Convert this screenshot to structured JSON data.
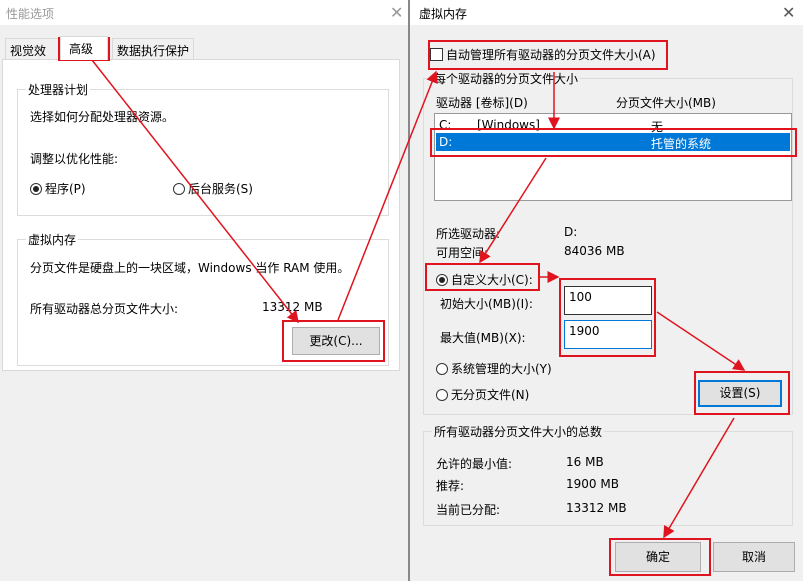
{
  "left_window": {
    "title": "性能选项",
    "tabs": [
      {
        "label": "视觉效果"
      },
      {
        "label": "高级",
        "selected": true
      },
      {
        "label": "数据执行保护"
      }
    ],
    "processor_group": {
      "title": "处理器计划",
      "description": "选择如何分配处理器资源。",
      "adjust_label": "调整以优化性能:",
      "options": [
        {
          "label": "程序(P)",
          "checked": true
        },
        {
          "label": "后台服务(S)",
          "checked": false
        }
      ]
    },
    "vm_group": {
      "title": "虚拟内存",
      "description": "分页文件是硬盘上的一块区域，Windows 当作 RAM 使用。",
      "total_label": "所有驱动器总分页文件大小:",
      "total_value": "13312 MB",
      "change_button": "更改(C)..."
    }
  },
  "right_window": {
    "title": "虚拟内存",
    "auto_manage": {
      "label": "自动管理所有驱动器的分页文件大小(A)",
      "checked": false
    },
    "drive_group": {
      "title": "每个驱动器的分页文件大小",
      "col_drive": "驱动器 [卷标](D)",
      "col_size": "分页文件大小(MB)",
      "drives": [
        {
          "letter": "C:",
          "label": "[Windows]",
          "size": "无",
          "selected": false
        },
        {
          "letter": "D:",
          "label": "",
          "size": "托管的系统",
          "selected": true
        }
      ],
      "selected_drive_label": "所选驱动器:",
      "selected_drive_value": "D:",
      "free_space_label": "可用空间:",
      "free_space_value": "84036 MB",
      "custom_size": "自定义大小(C):",
      "initial_label": "初始大小(MB)(I):",
      "initial_value": "100",
      "max_label": "最大值(MB)(X):",
      "max_value": "1900",
      "system_managed": "系统管理的大小(Y)",
      "no_paging": "无分页文件(N)",
      "set_button": "设置(S)"
    },
    "totals_group": {
      "title": "所有驱动器分页文件大小的总数",
      "min_label": "允许的最小值:",
      "min_value": "16 MB",
      "recommended_label": "推荐:",
      "recommended_value": "1900 MB",
      "current_label": "当前已分配:",
      "current_value": "13312 MB"
    },
    "ok_button": "确定",
    "cancel_button": "取消"
  },
  "colors": {
    "annotation": "#e0141e",
    "selection": "#0078d7"
  }
}
